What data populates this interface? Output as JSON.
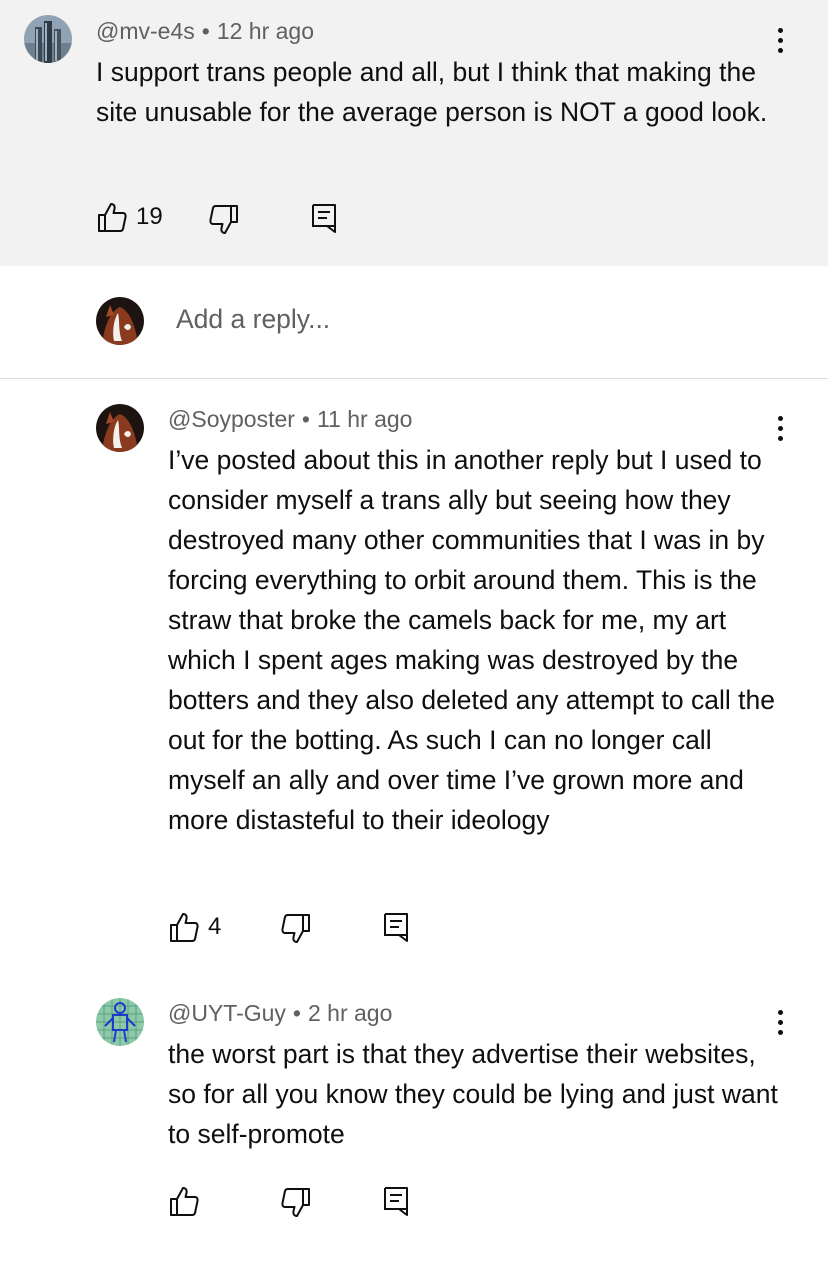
{
  "comment": {
    "handle": "@mv-e4s",
    "time": "12 hr ago",
    "separator": "•",
    "text": "I support trans people and all, but I think that making the site unusable for the average person is NOT a good look.",
    "likes": "19",
    "avatar_icon": "city-towers-avatar-icon"
  },
  "reply_box": {
    "placeholder": "Add a reply..."
  },
  "replies": [
    {
      "handle": "@Soyposter",
      "time": "11 hr ago",
      "separator": "•",
      "text": "I’ve posted about this in another reply but I used to consider myself a trans ally but seeing how they destroyed many other communities that I was in by forcing everything to orbit around them. This is the straw that broke the camels back for me, my art which I spent ages making was destroyed by the botters and they also deleted any attempt to call the out for the botting. As such I can no longer call myself an ally and over time I’ve grown more and more distasteful to their ideology",
      "likes": "4"
    },
    {
      "handle": "@UYT-Guy",
      "time": "2 hr ago",
      "separator": "•",
      "text": "the worst part is that they advertise their websites, so for all you know they could be lying and just want to self-promote",
      "likes": ""
    }
  ],
  "colors": {
    "top_background": "#f2f2f2",
    "meta_text": "#606060",
    "divider": "#dcdcdc"
  }
}
